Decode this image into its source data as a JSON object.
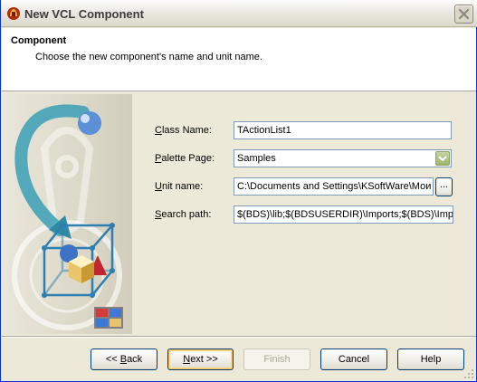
{
  "window": {
    "title": "New VCL Component"
  },
  "header": {
    "title": "Component",
    "description": "Choose the new component's name and unit name."
  },
  "form": {
    "class_name": {
      "label": "Class Name:",
      "access_key": "C",
      "label_rest": "lass Name:",
      "value": "TActionList1"
    },
    "palette_page": {
      "label": "Palette Page:",
      "access_key": "P",
      "label_rest": "alette Page:",
      "value": "Samples"
    },
    "unit_name": {
      "label": "Unit name:",
      "access_key": "U",
      "label_rest": "nit name:",
      "value": "C:\\Documents and Settings\\KSoftWare\\Мои",
      "browse_label": "..."
    },
    "search_path": {
      "label": "Search path:",
      "access_key": "S",
      "label_rest": "earch path:",
      "value": "$(BDS)\\lib;$(BDSUSERDIR)\\Imports;$(BDS)\\Impor"
    }
  },
  "buttons": {
    "back": {
      "pre": "<< ",
      "key": "B",
      "post": "ack"
    },
    "next": {
      "pre": "",
      "key": "N",
      "post": "ext >>"
    },
    "finish": "Finish",
    "cancel": "Cancel",
    "help": "Help"
  },
  "colors": {
    "title_bar_start": "#fdfdfd",
    "close_button": "#ce4322",
    "combo_arrow": "#9eb46c",
    "default_button_glow": "#f4c15f"
  },
  "icons": {
    "app": "delphi-helmet-icon",
    "close": "close-icon",
    "dropdown": "chevron-down-icon",
    "component_art": "component-cube-icon",
    "palette": "palette-grid-icon"
  }
}
